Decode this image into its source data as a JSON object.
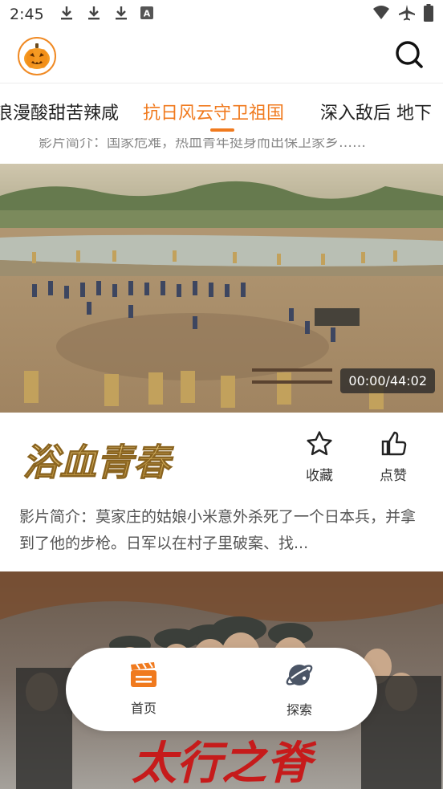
{
  "status_bar": {
    "time": "2:45",
    "left_icons": [
      "download-icon",
      "download-icon",
      "download-icon",
      "keyboard-a-icon"
    ],
    "right_icons": [
      "wifi-icon",
      "airplane-icon",
      "battery-icon"
    ]
  },
  "header": {
    "logo_icon": "pumpkin-logo-icon",
    "search_icon": "search-icon"
  },
  "tabs": [
    {
      "label": "浪漫酸甜苦辣咸",
      "active": false
    },
    {
      "label": "抗日风云守卫祖国",
      "active": true
    },
    {
      "label": "深入敌后 地下",
      "active": false
    }
  ],
  "previous_card": {
    "desc_partial": "影片简介：国家危难，热血青年挺身而出保卫家乡……"
  },
  "video_card": {
    "duration": "00:00/44:02",
    "title_art": "浴血青春",
    "actions": {
      "favorite_label": "收藏",
      "like_label": "点赞"
    },
    "synopsis": "影片简介：莫家庄的姑娘小米意外杀死了一个日本兵，并拿到了他的步枪。日军以在村子里破案、找..."
  },
  "next_card": {
    "title_art": "太行之脊"
  },
  "bottom_nav": {
    "items": [
      {
        "label": "首页",
        "icon": "clapperboard-icon"
      },
      {
        "label": "探索",
        "icon": "planet-icon"
      }
    ]
  },
  "colors": {
    "accent": "#f07a1e",
    "text": "#222222",
    "muted": "#555555"
  }
}
